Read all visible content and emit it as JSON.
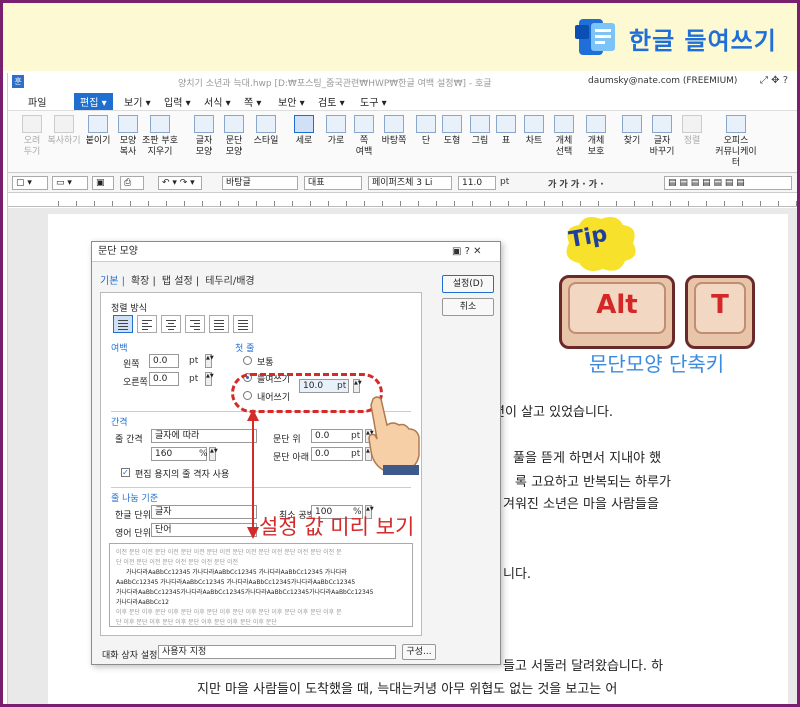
{
  "banner": {
    "title": "한글 들여쓰기",
    "brand_color": "#1e6fd8",
    "logo_icon": "office-logo-icon"
  },
  "window": {
    "icon_label": "훈",
    "document_title": "양치기 소년과 늑대.hwp [D:₩포스팅_줌국관련₩HWP₩한글 여백 설정₩] - 호글",
    "user": "daumsky@nate.com (FREEMIUM)",
    "controls": "⤢ ✥ ?"
  },
  "menu": {
    "items": [
      "파일",
      "편집",
      "보기",
      "입력",
      "서식",
      "쪽",
      "보안",
      "검토",
      "도구"
    ],
    "active": "편집"
  },
  "ribbon": {
    "buttons": [
      {
        "label": "오려\n두기",
        "icon": "scissors-icon",
        "enabled": false
      },
      {
        "label": "복사하기",
        "icon": "copy-icon",
        "enabled": false
      },
      {
        "label": "붙이기",
        "icon": "paste-icon",
        "enabled": true
      },
      {
        "label": "모양\n복사",
        "icon": "format-painter-icon",
        "enabled": true
      },
      {
        "label": "조판 부호\n지우기",
        "icon": "clear-format-icon",
        "enabled": true
      },
      {
        "label": "글자\n모양",
        "icon": "char-shape-icon",
        "enabled": true
      },
      {
        "label": "문단\n모양",
        "icon": "para-shape-icon",
        "enabled": true
      },
      {
        "label": "스타일",
        "icon": "style-icon",
        "enabled": true
      },
      {
        "label": "세로",
        "icon": "portrait-icon",
        "enabled": true,
        "selected": true
      },
      {
        "label": "가로",
        "icon": "landscape-icon",
        "enabled": true
      },
      {
        "label": "쪽\n여백",
        "icon": "page-margin-icon",
        "enabled": true
      },
      {
        "label": "바탕쪽",
        "icon": "master-page-icon",
        "enabled": true
      },
      {
        "label": "단",
        "icon": "columns-icon",
        "enabled": true
      },
      {
        "label": "도형",
        "icon": "shape-icon",
        "enabled": true
      },
      {
        "label": "그림",
        "icon": "picture-icon",
        "enabled": true
      },
      {
        "label": "표",
        "icon": "table-icon",
        "enabled": true
      },
      {
        "label": "차트",
        "icon": "chart-icon",
        "enabled": true
      },
      {
        "label": "개체\n선택",
        "icon": "select-object-icon",
        "enabled": true
      },
      {
        "label": "개체\n보호",
        "icon": "protect-object-icon",
        "enabled": true
      },
      {
        "label": "찾기",
        "icon": "find-icon",
        "enabled": true
      },
      {
        "label": "글자\n바꾸기",
        "icon": "replace-icon",
        "enabled": true
      },
      {
        "label": "정렬",
        "icon": "sort-icon",
        "enabled": false
      },
      {
        "label": "오피스\n커뮤니케이터",
        "icon": "communicator-icon",
        "enabled": true
      }
    ]
  },
  "format_bar": {
    "style": "바탕글",
    "para_style": "대표",
    "font": "페이퍼즈체 3 Li",
    "size": "11.0",
    "unit": "pt",
    "char_buttons": "가 가 가 · 가 ·"
  },
  "document": {
    "lines": [
      "년이 살고 있었습니다.",
      "풀을 뜯게 하면서 지내야 했",
      "록 고요하고 반복되는 하루가",
      "겨워진 소년은 마을 사람들을",
      "니다.",
      "들고 서둘러 달려왔습니다. 하",
      "지만 마을 사람들이 도착했을 때, 늑대는커녕 아무 위협도 없는 것을 보고는 어"
    ]
  },
  "dialog": {
    "title": "문단 모양",
    "title_controls": "▣ ? ✕",
    "tabs": [
      "기본",
      "확장",
      "탭 설정",
      "테두리/배경"
    ],
    "active_tab": "기본",
    "align_section": "정렬 방식",
    "margin_section": "여백",
    "first_line_section": "첫 줄",
    "left_label": "왼쪽",
    "left_value": "0.0",
    "right_label": "오른쪽",
    "right_value": "0.0",
    "unit_pt": "pt",
    "first_line_options": [
      "보통",
      "들여쓰기",
      "내어쓰기"
    ],
    "first_line_selected": "들여쓰기",
    "indent_value": "10.0",
    "spacing_section": "간격",
    "line_spacing_label": "줄 간격",
    "line_spacing_value": "글자에 따라",
    "line_spacing_percent": "160",
    "percent_unit": "%",
    "para_above_label": "문단 위",
    "para_above_value": "0.0",
    "para_below_label": "문단 아래",
    "para_below_value": "0.0",
    "grid_checkbox": "편집 용지의 줄 격자 사용",
    "grid_checked": true,
    "line_break_section": "줄 나눔 기준",
    "hangul_unit_label": "한글 단위",
    "hangul_unit_value": "글자",
    "min_space_label": "최소 공백",
    "min_space_value": "100",
    "english_unit_label": "영어 단위",
    "english_unit_value": "단어",
    "preview_text": [
      "이전 문단 이전 문단 이전 문단 이전 문단 이전 문단 이전 문단 이전 문단 이전 문단 이전 문",
      "단 이전 문단 이전 문단 이전 문단 이전 문단 이전",
      "가나다라AaBbCc12345   가나다라AaBbCc12345   가나다라AaBbCc12345   가나다라",
      "AaBbCc12345   가나다라AaBbCc12345   가나다라AaBbCc12345가나다라AaBbCc12345",
      "가나다라AaBbCc12345가나다라AaBbCc12345가나다라AaBbCc12345가나다라AaBbCc12345",
      "가나다라AaBbCc12",
      "이후 문단 이후 문단 이후 문단 이후 문단 이후 문단 이후 문단 이후 문단 이후 문단 이후 문",
      "단 이후 문단 이후 문단 이후 문단 이후 문단 이후 문단 이후 문단"
    ],
    "dialog_setting_label": "대화 상자 설정",
    "dialog_setting_value": "사용자 지정",
    "compose_button": "구성...",
    "ok_button": "설정(D)",
    "cancel_button": "취소"
  },
  "annotations": {
    "tip": "Tip",
    "key1": "Alt",
    "key2": "T",
    "shortcut_caption": "문단모양 단축키",
    "preview_caption": "설정 값 미리 보기",
    "accent_red": "#d32a2a",
    "accent_blue": "#3a8be0"
  }
}
